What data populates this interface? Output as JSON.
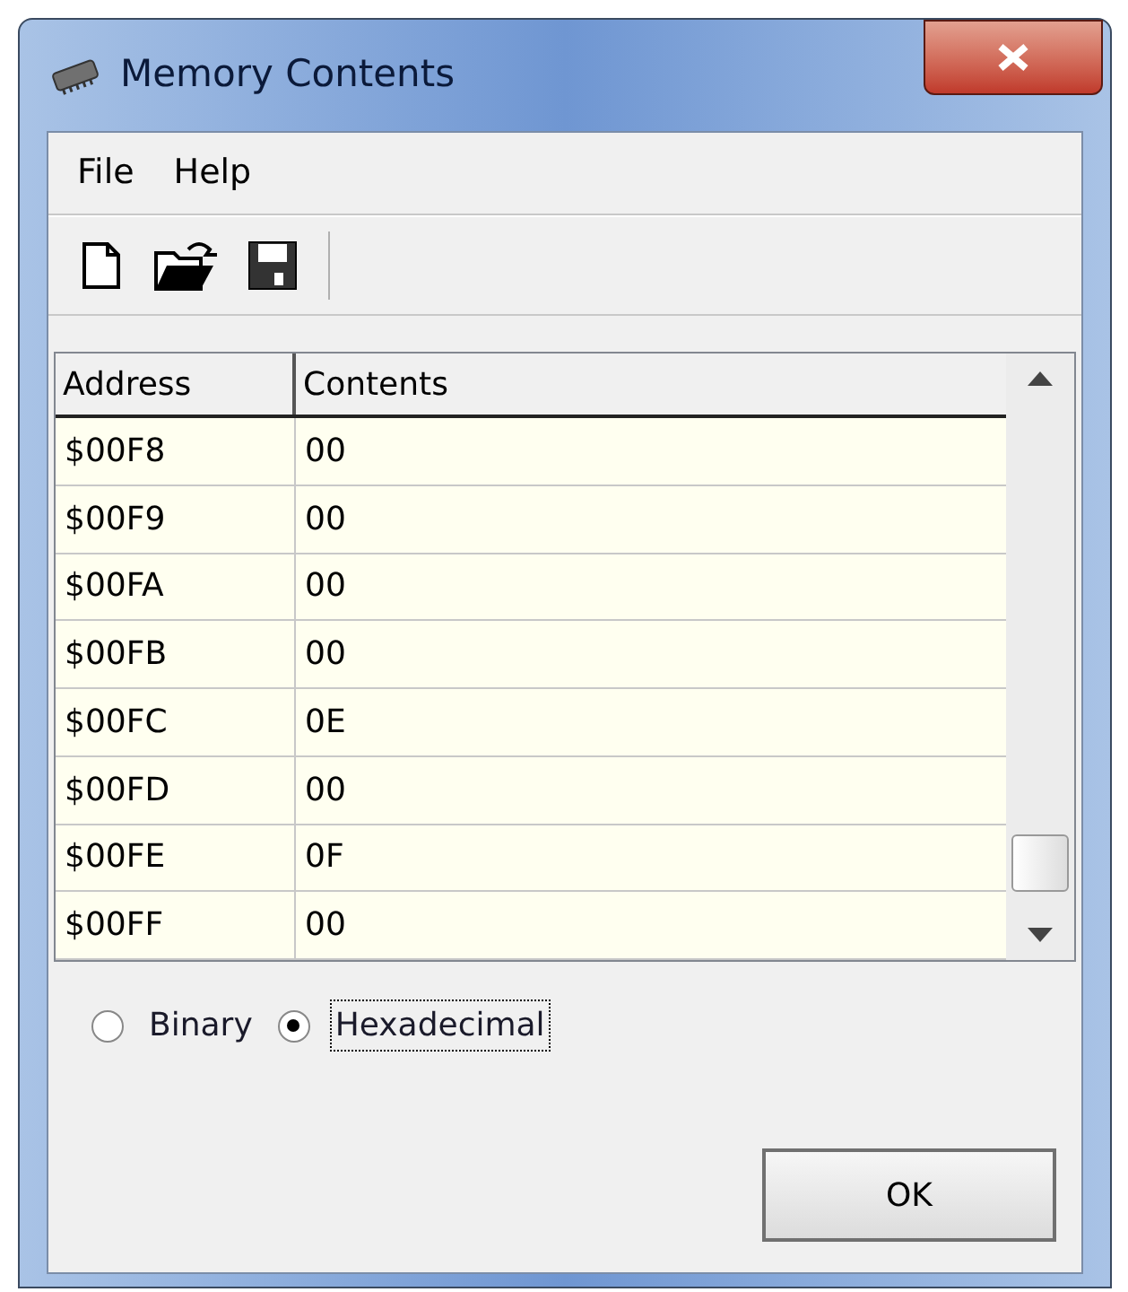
{
  "window": {
    "title": "Memory Contents"
  },
  "menu": [
    "File",
    "Help"
  ],
  "table": {
    "columns": [
      "Address",
      "Contents"
    ],
    "rows": [
      [
        "$00F8",
        "00"
      ],
      [
        "$00F9",
        "00"
      ],
      [
        "$00FA",
        "00"
      ],
      [
        "$00FB",
        "00"
      ],
      [
        "$00FC",
        "0E"
      ],
      [
        "$00FD",
        "00"
      ],
      [
        "$00FE",
        "0F"
      ],
      [
        "$00FF",
        "00"
      ]
    ]
  },
  "format": [
    {
      "label": "Binary",
      "selected": false
    },
    {
      "label": "Hexadecimal",
      "selected": true
    }
  ],
  "buttons": [
    "OK"
  ]
}
